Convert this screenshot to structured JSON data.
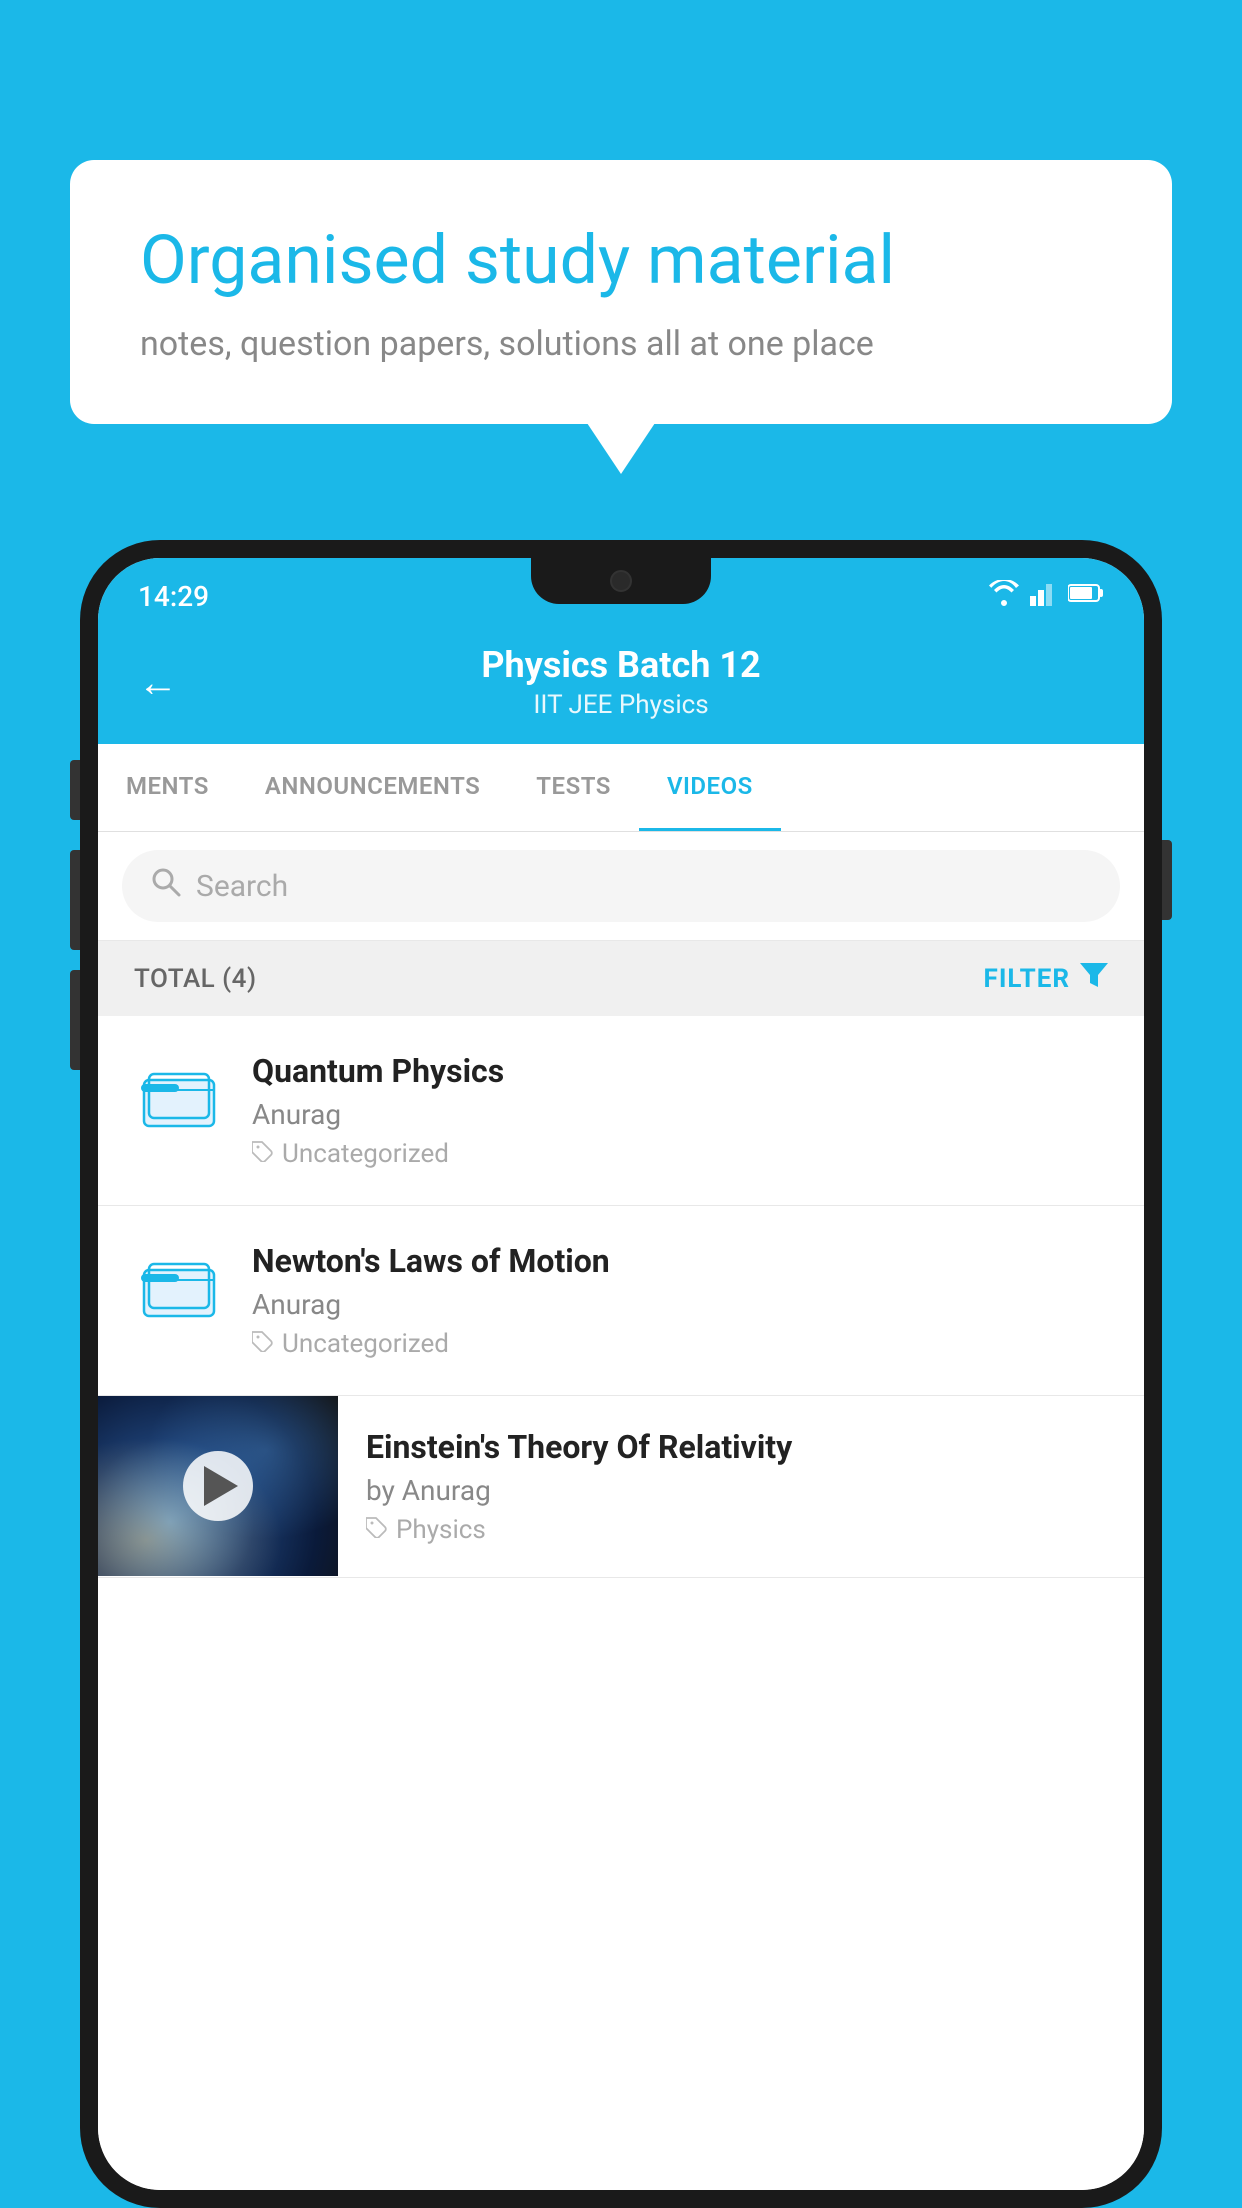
{
  "background_color": "#1bb8e8",
  "speech_bubble": {
    "title": "Organised study material",
    "subtitle": "notes, question papers, solutions all at one place"
  },
  "phone": {
    "status_bar": {
      "time": "14:29",
      "icons": [
        "wifi",
        "signal",
        "battery"
      ]
    },
    "header": {
      "back_label": "←",
      "title": "Physics Batch 12",
      "subtitle": "IIT JEE   Physics"
    },
    "tabs": [
      {
        "label": "MENTS",
        "active": false
      },
      {
        "label": "ANNOUNCEMENTS",
        "active": false
      },
      {
        "label": "TESTS",
        "active": false
      },
      {
        "label": "VIDEOS",
        "active": true
      }
    ],
    "search": {
      "placeholder": "Search"
    },
    "filter_bar": {
      "total_label": "TOTAL (4)",
      "filter_label": "FILTER"
    },
    "videos": [
      {
        "type": "folder",
        "title": "Quantum Physics",
        "author": "Anurag",
        "tag": "Uncategorized"
      },
      {
        "type": "folder",
        "title": "Newton's Laws of Motion",
        "author": "Anurag",
        "tag": "Uncategorized"
      },
      {
        "type": "video",
        "title": "Einstein's Theory Of Relativity",
        "author": "by Anurag",
        "tag": "Physics"
      }
    ]
  }
}
